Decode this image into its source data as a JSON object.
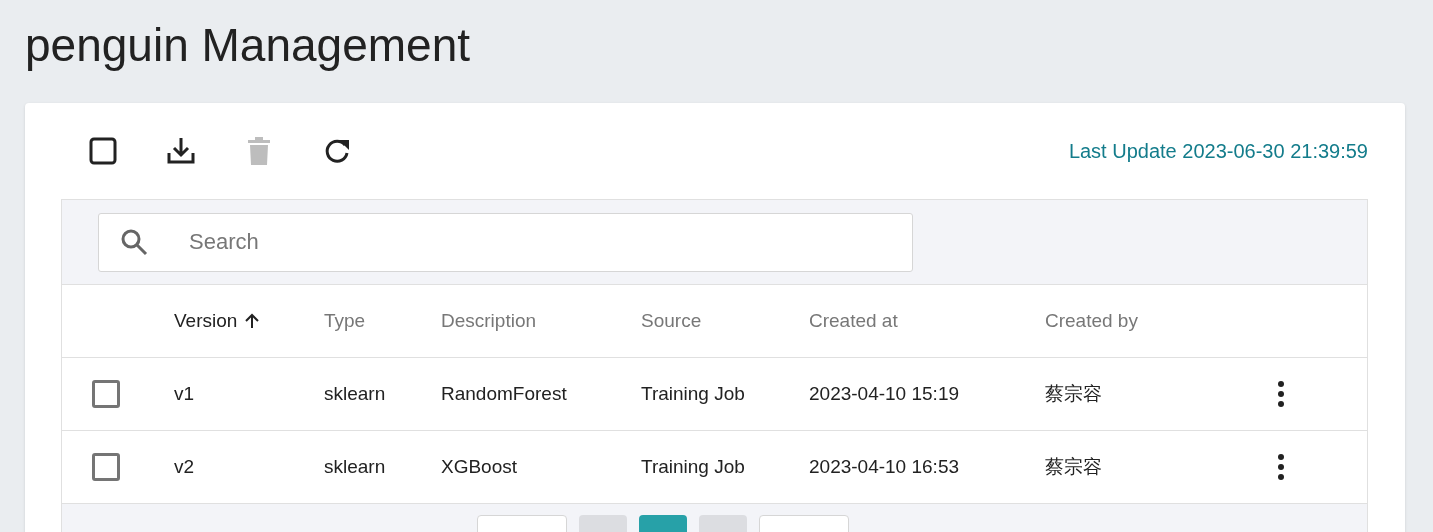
{
  "page_title": "penguin Management",
  "toolbar": {
    "select_all_checked": false,
    "delete_disabled": true,
    "last_update": "Last Update 2023-06-30 21:39:59"
  },
  "search": {
    "placeholder": "Search"
  },
  "table": {
    "columns": [
      {
        "label": "Version",
        "sorted": true
      },
      {
        "label": "Type",
        "sorted": false
      },
      {
        "label": "Description",
        "sorted": false
      },
      {
        "label": "Source",
        "sorted": false
      },
      {
        "label": "Created at",
        "sorted": false
      },
      {
        "label": "Created by",
        "sorted": false
      }
    ],
    "rows": [
      {
        "checked": false,
        "cells": [
          "v1",
          "sklearn",
          "RandomForest",
          "Training Job",
          "2023-04-10 15:19",
          "蔡宗容"
        ]
      },
      {
        "checked": false,
        "cells": [
          "v2",
          "sklearn",
          "XGBoost",
          "Training Job",
          "2023-04-10 16:53",
          "蔡宗容"
        ]
      }
    ]
  },
  "pagination": [
    {
      "kind": "nav",
      "selected": false
    },
    {
      "kind": "page",
      "selected": false
    },
    {
      "kind": "page",
      "selected": true
    },
    {
      "kind": "page",
      "selected": false
    },
    {
      "kind": "nav",
      "selected": false
    }
  ]
}
